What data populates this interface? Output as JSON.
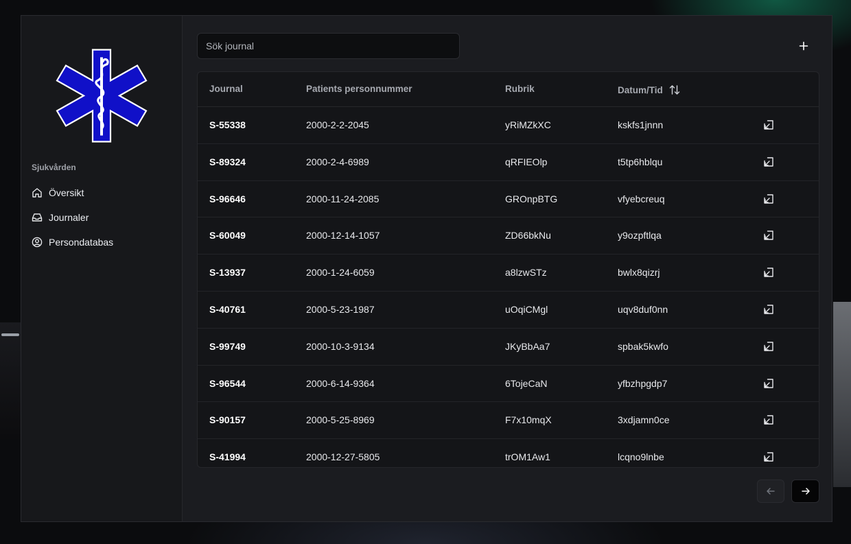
{
  "sidebar": {
    "section_title": "Sjukvården",
    "items": [
      {
        "label": "Översikt",
        "icon": "home-icon"
      },
      {
        "label": "Journaler",
        "icon": "inbox-icon"
      },
      {
        "label": "Persondatabas",
        "icon": "user-circle-icon"
      }
    ]
  },
  "search": {
    "placeholder": "Sök journal"
  },
  "table": {
    "headers": [
      "Journal",
      "Patients personnummer",
      "Rubrik",
      "Datum/Tid"
    ],
    "rows": [
      [
        "S-55338",
        "2000-2-2-2045",
        "yRiMZkXC",
        "kskfs1jnnn"
      ],
      [
        "S-89324",
        "2000-2-4-6989",
        "qRFIEOlp",
        "t5tp6hblqu"
      ],
      [
        "S-96646",
        "2000-11-24-2085",
        "GROnpBTG",
        "vfyebcreuq"
      ],
      [
        "S-60049",
        "2000-12-14-1057",
        "ZD66bkNu",
        "y9ozpftlqa"
      ],
      [
        "S-13937",
        "2000-1-24-6059",
        "a8lzwSTz",
        "bwlx8qizrj"
      ],
      [
        "S-40761",
        "2000-5-23-1987",
        "uOqiCMgl",
        "uqv8duf0nn"
      ],
      [
        "S-99749",
        "2000-10-3-9134",
        "JKyBbAa7",
        "spbak5kwfo"
      ],
      [
        "S-96544",
        "2000-6-14-9364",
        "6TojeCaN",
        "yfbzhpgdp7"
      ],
      [
        "S-90157",
        "2000-5-25-8969",
        "F7x10mqX",
        "3xdjamn0ce"
      ],
      [
        "S-41994",
        "2000-12-27-5805",
        "trOM1Aw1",
        "lcqno9lnbe"
      ]
    ]
  },
  "colors": {
    "logo_blue": "#1010c8",
    "panel": "#1b1c20",
    "table_bg": "#141518"
  }
}
